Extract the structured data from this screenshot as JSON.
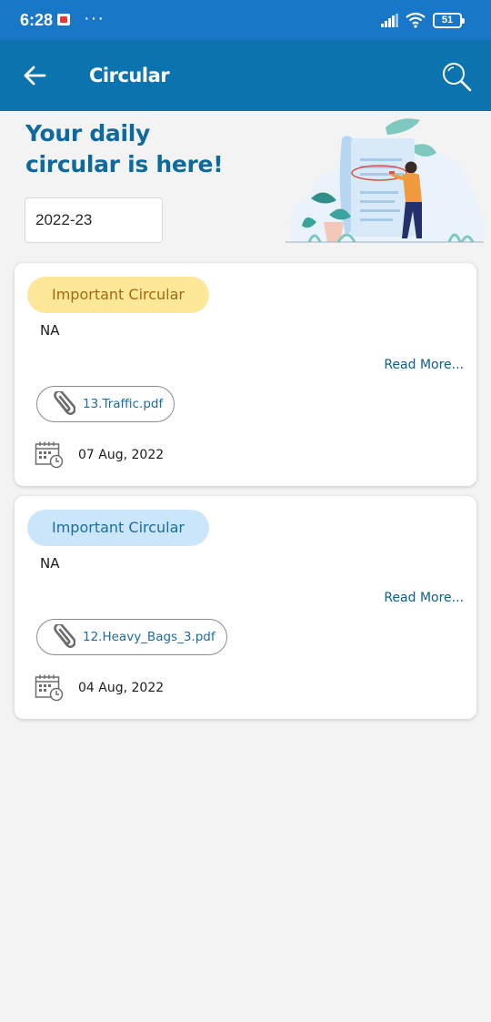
{
  "status_bar": {
    "time": "6:28",
    "battery": "51",
    "app_icon": "notification-app-icon",
    "overflow_dots": "···"
  },
  "app_bar": {
    "title": "Circular",
    "back_icon": "arrow-left-icon",
    "search_icon": "search-icon"
  },
  "hero": {
    "title_line1": "Your daily",
    "title_line2": "circular is here!",
    "illustration": "person-reading-document-illustration"
  },
  "filter": {
    "year": "2022-23"
  },
  "circulars": [
    {
      "badge": "Important Circular",
      "badge_color": "#fde89a",
      "text": "NA",
      "read_more": "Read More...",
      "attachment": "13.Traffic.pdf",
      "date": "07 Aug, 2022"
    },
    {
      "badge": "Important Circular",
      "badge_color": "#cbe6fb",
      "text": "NA",
      "read_more": "Read More...",
      "attachment": "12.Heavy_Bags_3.pdf",
      "date": "04 Aug, 2022"
    }
  ],
  "colors": {
    "status_bar": "#1877c7",
    "app_bar": "#0b73ad",
    "accent_text": "#0e6a9c"
  }
}
